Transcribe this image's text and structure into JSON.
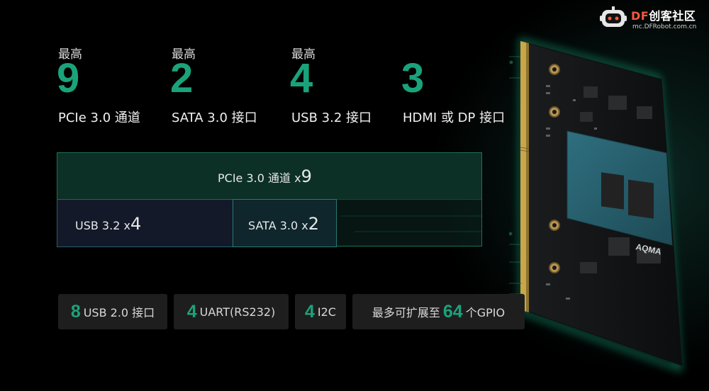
{
  "logo": {
    "brand_df": "DF",
    "brand_rest": "创客社区",
    "url": "mc.DFRobot.com.cn"
  },
  "stats": [
    {
      "prefix": "最高",
      "number": "9",
      "label": "PCIe 3.0 通道"
    },
    {
      "prefix": "最高",
      "number": "2",
      "label": "SATA 3.0 接口"
    },
    {
      "prefix": "最高",
      "number": "4",
      "label": "USB 3.2 接口"
    },
    {
      "prefix": "",
      "number": "3",
      "label": "HDMI 或 DP 接口"
    }
  ],
  "diagram": {
    "pcie": {
      "label": "PCIe 3.0 通道 x",
      "count": "9"
    },
    "usb": {
      "label": "USB 3.2 x",
      "count": "4"
    },
    "sata": {
      "label": "SATA 3.0 x",
      "count": "2"
    }
  },
  "features": [
    {
      "number": "8",
      "label": "USB 2.0 接口"
    },
    {
      "number": "4",
      "label": "UART(RS232)"
    },
    {
      "number": "4",
      "label": "I2C"
    },
    {
      "prefix": "最多可扩展至",
      "number": "64",
      "label": "个GPIO"
    }
  ],
  "board_marking": "AQMA",
  "colors": {
    "accent_green": "#1aa37a",
    "background": "#000000",
    "chip_bg": "#1e1e1e",
    "logo_red": "#f35a3c"
  }
}
